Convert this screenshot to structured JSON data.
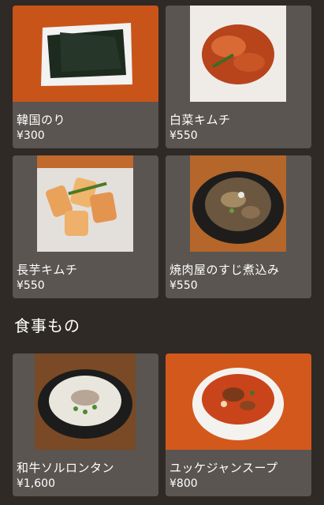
{
  "sections": [
    {
      "items": [
        {
          "name": "韓国のり",
          "price": "¥300",
          "icon": "seaweed-photo"
        },
        {
          "name": "白菜キムチ",
          "price": "¥550",
          "icon": "kimchi-photo"
        },
        {
          "name": "長芋キムチ",
          "price": "¥550",
          "icon": "yam-kimchi-photo"
        },
        {
          "name": "焼肉屋のすじ煮込み",
          "price": "¥550",
          "icon": "tendon-stew-photo"
        }
      ]
    },
    {
      "title": "食事もの",
      "items": [
        {
          "name": "和牛ソルロンタン",
          "price": "¥1,600",
          "icon": "seolleongtang-photo"
        },
        {
          "name": "ユッケジャンスープ",
          "price": "¥800",
          "icon": "yukgaejang-photo"
        }
      ]
    }
  ],
  "colors": {
    "background": "#2f2a25",
    "card": "#5a5551",
    "text": "#ffffff"
  }
}
